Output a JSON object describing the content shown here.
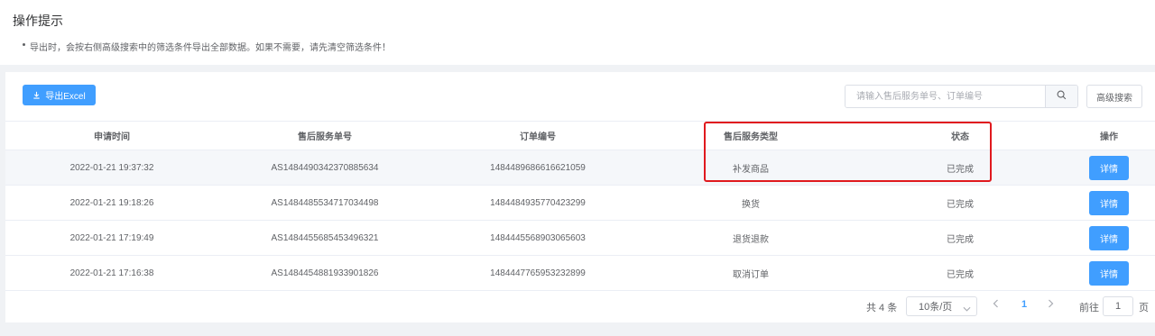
{
  "tips": {
    "title": "操作提示",
    "items": [
      "导出时，会按右侧高级搜索中的筛选条件导出全部数据。如果不需要，请先清空筛选条件！"
    ]
  },
  "toolbar": {
    "export_label": "导出Excel",
    "search_placeholder": "请输入售后服务单号、订单编号",
    "advanced_label": "高级搜索"
  },
  "table": {
    "columns": [
      "申请时间",
      "售后服务单号",
      "订单编号",
      "售后服务类型",
      "状态",
      "操作"
    ],
    "rows": [
      [
        "2022-01-21 19:37:32",
        "AS1484490342370885634",
        "1484489686616621059",
        "补发商品",
        "已完成",
        "详情"
      ],
      [
        "2022-01-21 19:18:26",
        "AS1484485534717034498",
        "1484484935770423299",
        "换货",
        "已完成",
        "详情"
      ],
      [
        "2022-01-21 17:19:49",
        "AS1484455685453496321",
        "1484445568903065603",
        "退货退款",
        "已完成",
        "详情"
      ],
      [
        "2022-01-21 17:16:38",
        "AS1484454881933901826",
        "1484447765953232899",
        "取消订单",
        "已完成",
        "详情"
      ]
    ]
  },
  "pager": {
    "total": "共 4 条",
    "page_size": "10条/页",
    "current_page": "1",
    "goto_label": "前往",
    "goto_value": "1",
    "page_label": "页"
  },
  "colors": {
    "primary": "#409eff",
    "highlight_border": "#e0191e"
  }
}
